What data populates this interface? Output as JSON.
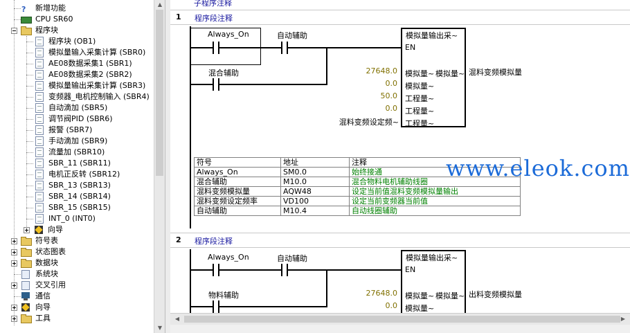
{
  "tree": {
    "items": [
      {
        "label": "新增功能"
      },
      {
        "label": "CPU SR60"
      },
      {
        "label": "程序块"
      },
      {
        "label": "程序块 (OB1)"
      },
      {
        "label": "模拟量输入采集计算 (SBR0)"
      },
      {
        "label": "AE08数据采集1 (SBR1)"
      },
      {
        "label": "AE08数据采集2 (SBR2)"
      },
      {
        "label": "模拟量输出采集计算 (SBR3)"
      },
      {
        "label": "变频器_电机控制输入 (SBR4)"
      },
      {
        "label": "自动滴加 (SBR5)"
      },
      {
        "label": "调节阀PID (SBR6)"
      },
      {
        "label": "报警 (SBR7)"
      },
      {
        "label": "手动滴加 (SBR9)"
      },
      {
        "label": "流量加 (SBR10)"
      },
      {
        "label": "SBR_11 (SBR11)"
      },
      {
        "label": "电机正反转 (SBR12)"
      },
      {
        "label": "SBR_13 (SBR13)"
      },
      {
        "label": "SBR_14 (SBR14)"
      },
      {
        "label": "SBR_15 (SBR15)"
      },
      {
        "label": "INT_0 (INT0)"
      },
      {
        "label": "向导"
      },
      {
        "label": "符号表"
      },
      {
        "label": "状态图表"
      },
      {
        "label": "数据块"
      },
      {
        "label": "系统块"
      },
      {
        "label": "交叉引用"
      },
      {
        "label": "通信"
      },
      {
        "label": "向导"
      },
      {
        "label": "工具"
      }
    ]
  },
  "editor": {
    "top_comment": "子程序注释",
    "networks": [
      {
        "number": "1",
        "title": "程序段注释",
        "contact1": "Always_On",
        "contact2": "自动辅助",
        "contact3": "混合辅助",
        "block_name": "模拟量输出采~",
        "en": "EN",
        "inputs": [
          {
            "pin": "模拟量~",
            "value": "27648.0"
          },
          {
            "pin": "模拟量~",
            "value": "0.0"
          },
          {
            "pin": "工程量~",
            "value": "50.0"
          },
          {
            "pin": "工程量~",
            "value": "0.0"
          },
          {
            "pin": "工程量~",
            "value": "混料变频设定频~"
          }
        ],
        "output_pin": "模拟量~",
        "output_value": "混料变频模拟量",
        "symbol_table": {
          "headers": [
            "符号",
            "地址",
            "注释"
          ],
          "rows": [
            [
              "Always_On",
              "SM0.0",
              "始终接通"
            ],
            [
              "混合辅助",
              "M10.0",
              "混合物料电机辅助线圈"
            ],
            [
              "混料变频模拟量",
              "AQW48",
              "设定当前值混料变频模拟量输出"
            ],
            [
              "混料变频设定频率",
              "VD100",
              "设定当前变频器当前值"
            ],
            [
              "自动辅助",
              "M10.4",
              "自动线圈辅助"
            ]
          ]
        }
      },
      {
        "number": "2",
        "title": "程序段注释",
        "contact1": "Always_On",
        "contact2": "自动辅助",
        "contact3": "物料辅助",
        "block_name": "模拟量输出采~",
        "en": "EN",
        "inputs": [
          {
            "pin": "模拟量~",
            "value": "27648.0"
          },
          {
            "pin": "模拟量~",
            "value": "0.0"
          }
        ],
        "output_pin": "模拟量~",
        "output_value": "出料变频模拟量"
      }
    ]
  },
  "watermark": "www.eleok.com"
}
